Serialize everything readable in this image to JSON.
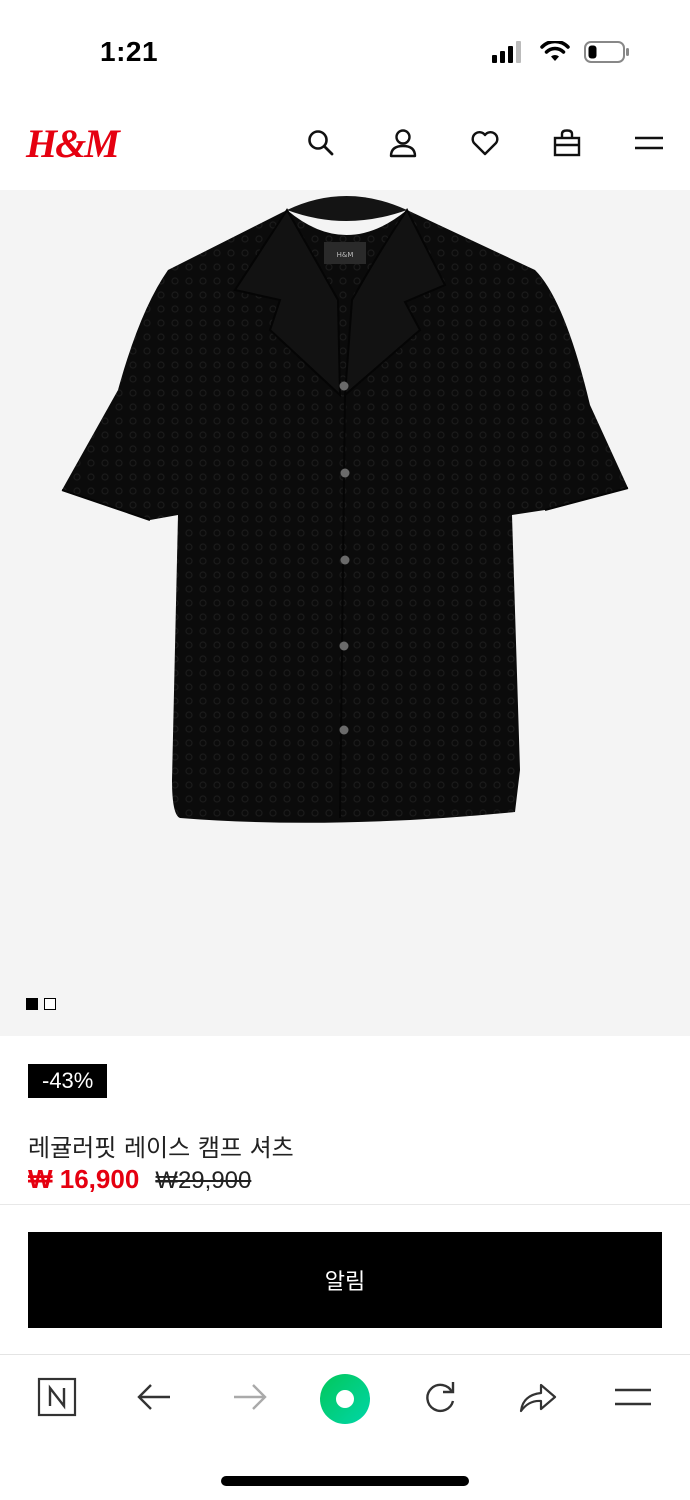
{
  "status_bar": {
    "time": "1:21"
  },
  "header": {
    "logo_text": "H&M",
    "brand_color": "#e50010",
    "icons": [
      "search-icon",
      "account-icon",
      "favorites-icon",
      "bag-icon",
      "menu-icon"
    ]
  },
  "gallery": {
    "image_count": 2,
    "active_index": 0
  },
  "product": {
    "discount_badge": "-43%",
    "title": "레귤러핏 레이스 캠프 셔츠",
    "price_current": "₩ 16,900",
    "price_original": "₩29,900",
    "price_color": "#e50010"
  },
  "actions": {
    "notify_label": "알림"
  },
  "browser_toolbar": {
    "icons": [
      "naver-icon",
      "back-icon",
      "forward-icon",
      "green-dot-icon",
      "reload-icon",
      "share-icon",
      "menu-icon"
    ],
    "accent_color": "#03c75a"
  }
}
